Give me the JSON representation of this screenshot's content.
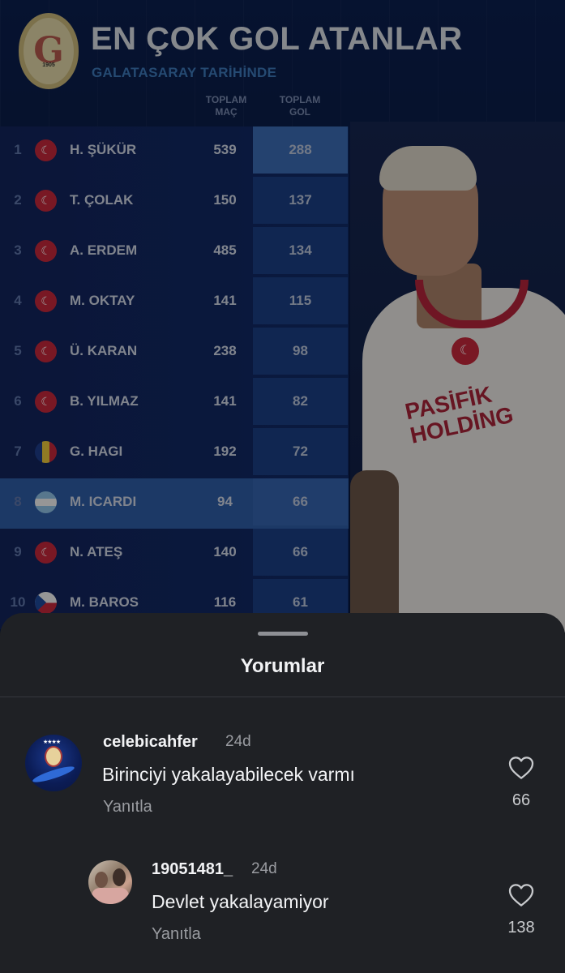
{
  "post": {
    "title": "EN ÇOK GOL ATANLAR",
    "subtitle": "GALATASARAY TARİHİNDE",
    "logo_year": "1905",
    "col_matches": "TOPLAM\nMAÇ",
    "col_goals": "TOPLAM\nGOL",
    "sponsor": "PASİFİK\nHOLDİNG",
    "rows": [
      {
        "rank": "1",
        "name": "H. ŞÜKÜR",
        "matches": "539",
        "goals": "288",
        "flag": "tr"
      },
      {
        "rank": "2",
        "name": "T. ÇOLAK",
        "matches": "150",
        "goals": "137",
        "flag": "tr"
      },
      {
        "rank": "3",
        "name": "A. ERDEM",
        "matches": "485",
        "goals": "134",
        "flag": "tr"
      },
      {
        "rank": "4",
        "name": "M. OKTAY",
        "matches": "141",
        "goals": "115",
        "flag": "tr"
      },
      {
        "rank": "5",
        "name": "Ü. KARAN",
        "matches": "238",
        "goals": "98",
        "flag": "tr"
      },
      {
        "rank": "6",
        "name": "B. YILMAZ",
        "matches": "141",
        "goals": "82",
        "flag": "tr"
      },
      {
        "rank": "7",
        "name": "G. HAGI",
        "matches": "192",
        "goals": "72",
        "flag": "ro"
      },
      {
        "rank": "8",
        "name": "M. ICARDI",
        "matches": "94",
        "goals": "66",
        "flag": "ar"
      },
      {
        "rank": "9",
        "name": "N. ATEŞ",
        "matches": "140",
        "goals": "66",
        "flag": "tr"
      },
      {
        "rank": "10",
        "name": "M. BAROS",
        "matches": "116",
        "goals": "61",
        "flag": "cz"
      }
    ]
  },
  "sheet": {
    "title": "Yorumlar",
    "comments": [
      {
        "username": "celebicahfer",
        "time": "24d",
        "text": "Birinciyi yakalayabilecek varmı",
        "reply": "Yanıtla",
        "likes": "66"
      },
      {
        "username": "19051481_",
        "time": "24d",
        "text": "Devlet yakalayamiyor",
        "reply": "Yanıtla",
        "likes": "138"
      }
    ]
  },
  "colors": {
    "sheet_bg": "#1f2125",
    "post_bg": "#0b1f4e",
    "highlight_row": "#2e5ca5",
    "goal_column": "#1b3e84"
  },
  "icons": {
    "like": "heart-outline-icon",
    "flag_tr": "turkey-flag-icon",
    "flag_ro": "romania-flag-icon",
    "flag_ar": "argentina-flag-icon",
    "flag_cz": "czech-flag-icon"
  }
}
